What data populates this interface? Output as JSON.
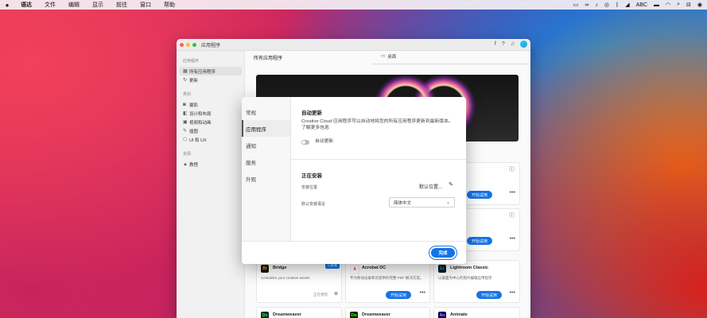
{
  "menubar": {
    "apple": "",
    "items": [
      "语达",
      "文件",
      "编辑",
      "显示",
      "前往",
      "窗口",
      "帮助"
    ],
    "status": [
      "ABC"
    ]
  },
  "window": {
    "title": "应用程序",
    "sidebar": {
      "section1": "应用程序",
      "item_all": "所有应用程序",
      "item_updates": "更新",
      "section2": "类别",
      "item_photo": "摄影",
      "item_design": "设计和布局",
      "item_video": "视频和动画",
      "item_illustration": "插图",
      "item_uiux": "UI 和 UX",
      "section3": "资源",
      "item_tutorials": "教程"
    },
    "main": {
      "heading": "所有应用程序",
      "tab_desktop": "桌面"
    },
    "cards": {
      "bridge_name": "Bridge",
      "bridge_desc": "Centralize your creative assets",
      "bridge_tag": "已安装",
      "bridge_status": "正在更新",
      "acrobat_name": "Acrobat DC",
      "acrobat_desc": "专为移动设备和云提供的完整 PDF 解决方案。",
      "lightroom_name": "Lightroom Classic",
      "lightroom_desc": "以桌面为中心的照片编辑应用程序",
      "trial_label": "开始试用",
      "more": "•••",
      "row3_a": "Dreamweaver",
      "row3_b": "Dreamweaver",
      "row3_c": "Animate",
      "right_a_name": "m",
      "right_b_name": "fects"
    }
  },
  "modal": {
    "nav": [
      "常规",
      "应用程序",
      "通知",
      "服务",
      "外观"
    ],
    "auto_update_title": "自动更新",
    "auto_update_desc": "Creative Cloud 应用程序可以自动地将您的所有应用程序更新到最新版本。了解更多信息",
    "auto_update_toggle": "自动更新",
    "installing_title": "正在安装",
    "install_location_label": "安装位置",
    "install_location_value": "默认位置...",
    "language_label": "默认安装语言",
    "language_value": "简体中文",
    "done": "完成"
  },
  "colors": {
    "accent": "#1473e6"
  }
}
